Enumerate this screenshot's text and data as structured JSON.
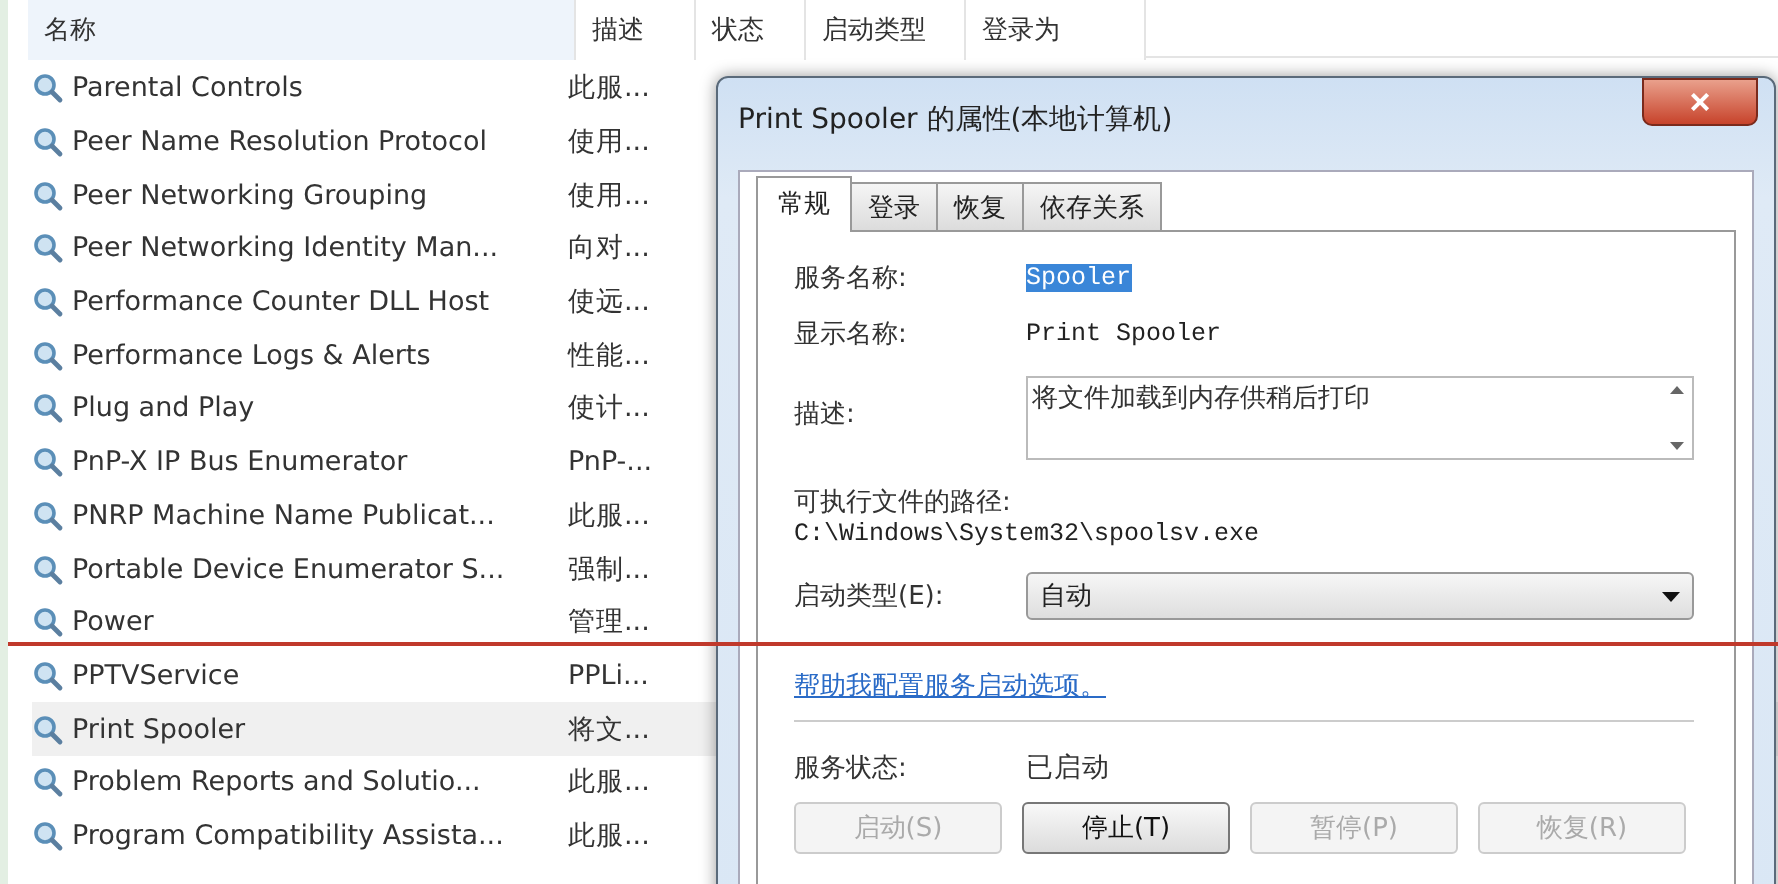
{
  "services": {
    "columns": [
      "名称",
      "描述",
      "状态",
      "启动类型",
      "登录为"
    ],
    "rows": [
      {
        "name": "Parental Controls",
        "description": "此服...",
        "selected": false
      },
      {
        "name": "Peer Name Resolution Protocol",
        "description": "使用...",
        "selected": false
      },
      {
        "name": "Peer Networking Grouping",
        "description": "使用...",
        "selected": false
      },
      {
        "name": "Peer Networking Identity Man...",
        "description": "向对...",
        "selected": false
      },
      {
        "name": "Performance Counter DLL Host",
        "description": "使远...",
        "selected": false
      },
      {
        "name": "Performance Logs & Alerts",
        "description": "性能...",
        "selected": false
      },
      {
        "name": "Plug and Play",
        "description": "使计...",
        "selected": false
      },
      {
        "name": "PnP-X IP Bus Enumerator",
        "description": "PnP-...",
        "selected": false
      },
      {
        "name": "PNRP Machine Name Publicat...",
        "description": "此服...",
        "selected": false
      },
      {
        "name": "Portable Device Enumerator S...",
        "description": "强制...",
        "selected": false
      },
      {
        "name": "Power",
        "description": "管理...",
        "selected": false
      },
      {
        "name": "PPTVService",
        "description": "PPLi...",
        "selected": false
      },
      {
        "name": "Print Spooler",
        "description": "将文...",
        "selected": true
      },
      {
        "name": "Problem Reports and Solutio...",
        "description": "此服...",
        "selected": false
      },
      {
        "name": "Program Compatibility Assista...",
        "description": "此服...",
        "selected": false
      }
    ]
  },
  "dialog": {
    "title": "Print Spooler 的属性(本地计算机)",
    "close": "×",
    "tabs": [
      {
        "label": "常规",
        "selected": true
      },
      {
        "label": "登录",
        "selected": false
      },
      {
        "label": "恢复",
        "selected": false
      },
      {
        "label": "依存关系",
        "selected": false
      }
    ],
    "service_name_label": "服务名称:",
    "service_name": "Spooler",
    "display_name_label": "显示名称:",
    "display_name": "Print Spooler",
    "description_label": "描述:",
    "description": "将文件加载到内存供稍后打印",
    "path_label": "可执行文件的路径:",
    "path": "C:\\Windows\\System32\\spoolsv.exe",
    "startup_type_label": "启动类型(E):",
    "startup_type": "自动",
    "help_link": "帮助我配置服务启动选项。",
    "status_label": "服务状态:",
    "status": "已启动",
    "buttons": [
      {
        "label": "启动(S)",
        "disabled": true
      },
      {
        "label": "停止(T)",
        "disabled": false
      },
      {
        "label": "暂停(P)",
        "disabled": true
      },
      {
        "label": "恢复(R)",
        "disabled": true
      }
    ]
  }
}
